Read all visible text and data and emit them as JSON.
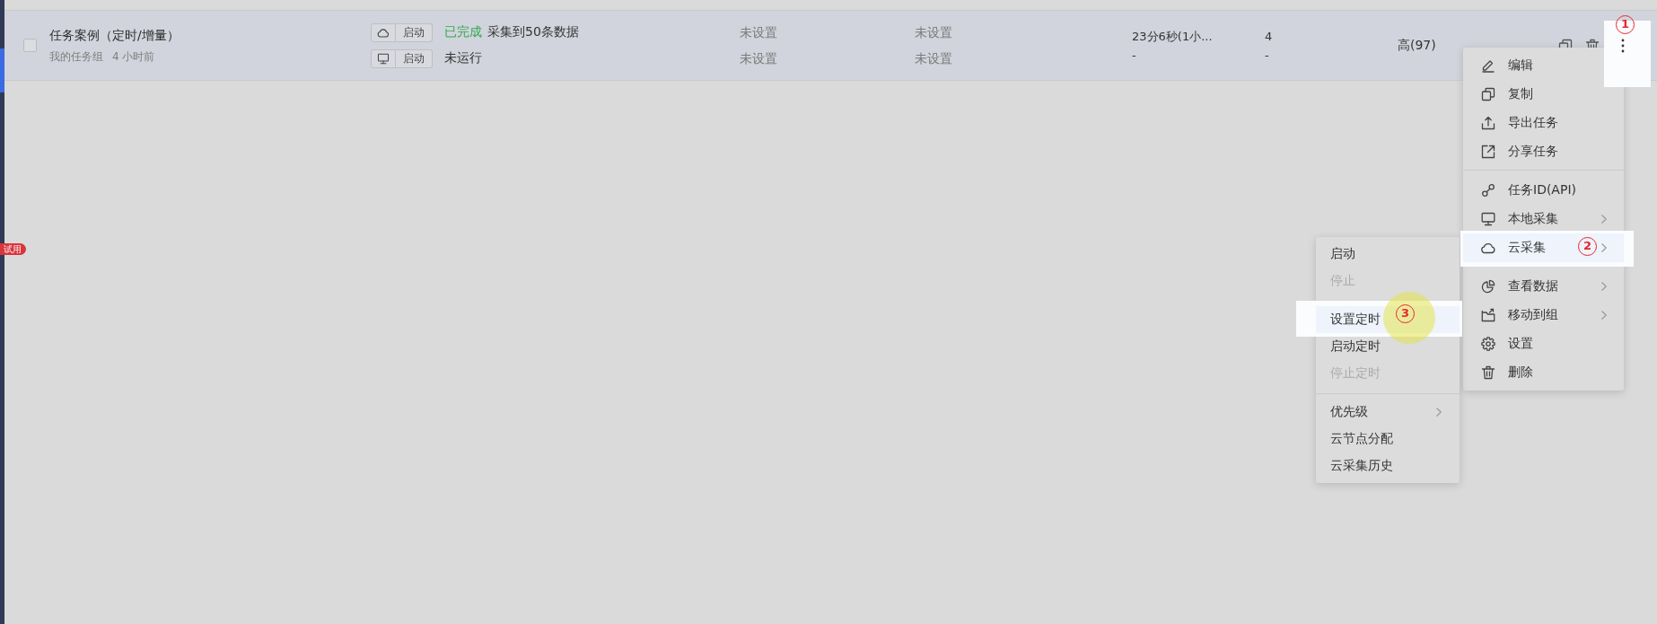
{
  "sidebar": {
    "badge": "试用"
  },
  "task_list": {
    "rows": [
      {
        "selected": true,
        "checked": false,
        "name": "任务案例（定时/增量）",
        "group": "我的任务组",
        "updated": "4 小时前",
        "runs": [
          {
            "kind": "cloud",
            "button": "启动",
            "status": "已完成",
            "completed": true,
            "detail": "采集到50条数据",
            "column_4": "未设置",
            "column_5": "未设置",
            "column_6": "23分6秒(1小...",
            "column_7": "4"
          },
          {
            "kind": "local",
            "button": "启动",
            "status": "未运行",
            "completed": false,
            "column_4": "未设置",
            "column_5": "未设置",
            "column_6": "-",
            "column_7": "-"
          }
        ],
        "column_8": "高(97)"
      }
    ]
  },
  "context_menu": {
    "groups": [
      {
        "items": [
          {
            "label": "编辑",
            "submenu": false,
            "selected": false
          },
          {
            "label": "复制",
            "submenu": false,
            "selected": false
          },
          {
            "label": "导出任务",
            "submenu": false,
            "selected": false
          },
          {
            "label": "分享任务",
            "submenu": false,
            "selected": false
          }
        ]
      },
      {
        "items": [
          {
            "label": "任务ID(API)",
            "submenu": false,
            "selected": false
          },
          {
            "label": "本地采集",
            "submenu": true,
            "selected": false
          },
          {
            "label": "云采集",
            "submenu": true,
            "selected": true
          }
        ]
      },
      {
        "items": [
          {
            "label": "查看数据",
            "submenu": true,
            "selected": false
          },
          {
            "label": "移动到组",
            "submenu": true,
            "selected": false
          },
          {
            "label": "设置",
            "submenu": false,
            "selected": false
          },
          {
            "label": "删除",
            "submenu": false,
            "selected": false
          }
        ]
      }
    ]
  },
  "submenu": {
    "groups": [
      {
        "items": [
          {
            "label": "启动",
            "disabled": false,
            "submenu": false,
            "selected": false
          },
          {
            "label": "停止",
            "disabled": true,
            "submenu": false,
            "selected": false
          }
        ]
      },
      {
        "items": [
          {
            "label": "设置定时",
            "disabled": false,
            "submenu": false,
            "selected": true
          },
          {
            "label": "启动定时",
            "disabled": false,
            "submenu": false,
            "selected": false
          },
          {
            "label": "停止定时",
            "disabled": true,
            "submenu": false,
            "selected": false
          }
        ]
      },
      {
        "items": [
          {
            "label": "优先级",
            "disabled": false,
            "submenu": true,
            "selected": false
          },
          {
            "label": "云节点分配",
            "disabled": false,
            "submenu": false,
            "selected": false
          },
          {
            "label": "云采集历史",
            "disabled": false,
            "submenu": false,
            "selected": false
          }
        ]
      }
    ]
  },
  "tutorial_marks": [
    {
      "label": "1",
      "click_marker": false
    },
    {
      "label": "2",
      "click_marker": false
    },
    {
      "label": "3",
      "click_marker": true
    }
  ]
}
